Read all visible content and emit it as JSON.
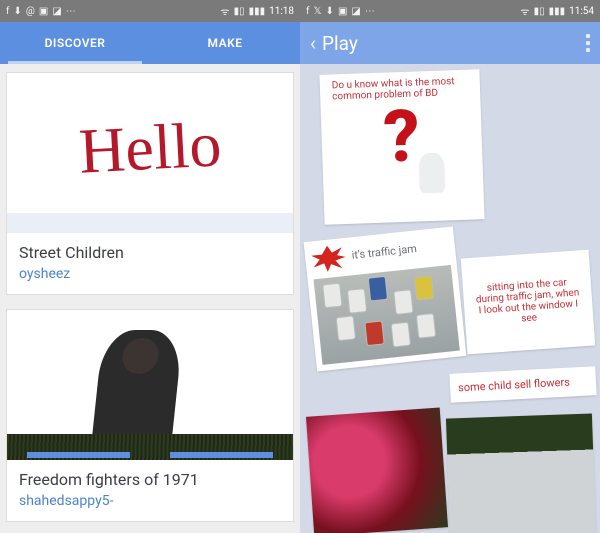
{
  "left": {
    "status": {
      "time": "11:18",
      "icons_left": [
        "facebook-icon",
        "download-icon",
        "at-icon",
        "app-icon",
        "crop-icon",
        "more-icon"
      ],
      "icons_right": [
        "wifi-icon",
        "signal-icon",
        "battery-icon"
      ]
    },
    "tabs": [
      {
        "label": "DISCOVER",
        "active": true
      },
      {
        "label": "MAKE",
        "active": false
      }
    ],
    "cards": [
      {
        "image_text": "Hello",
        "title": "Street Children",
        "author": "oysheez"
      },
      {
        "title": "Freedom fighters of 1971",
        "author": "shahedsappy5-"
      }
    ]
  },
  "right": {
    "status": {
      "time": "11:54",
      "icons_left": [
        "facebook-icon",
        "twitter-icon",
        "download-icon",
        "app-icon",
        "crop-icon",
        "more-icon"
      ],
      "icons_right": [
        "wifi-icon",
        "signal-icon",
        "battery-icon"
      ]
    },
    "header": {
      "back": "‹",
      "title": "Play"
    },
    "slides": [
      {
        "text": "Do u know what is the most common problem of BD"
      },
      {
        "text": "it's traffic jam"
      },
      {
        "text": "sitting into the car during traffic jam, when I look out the window I see"
      },
      {
        "text": "some child sell flowers"
      }
    ]
  }
}
